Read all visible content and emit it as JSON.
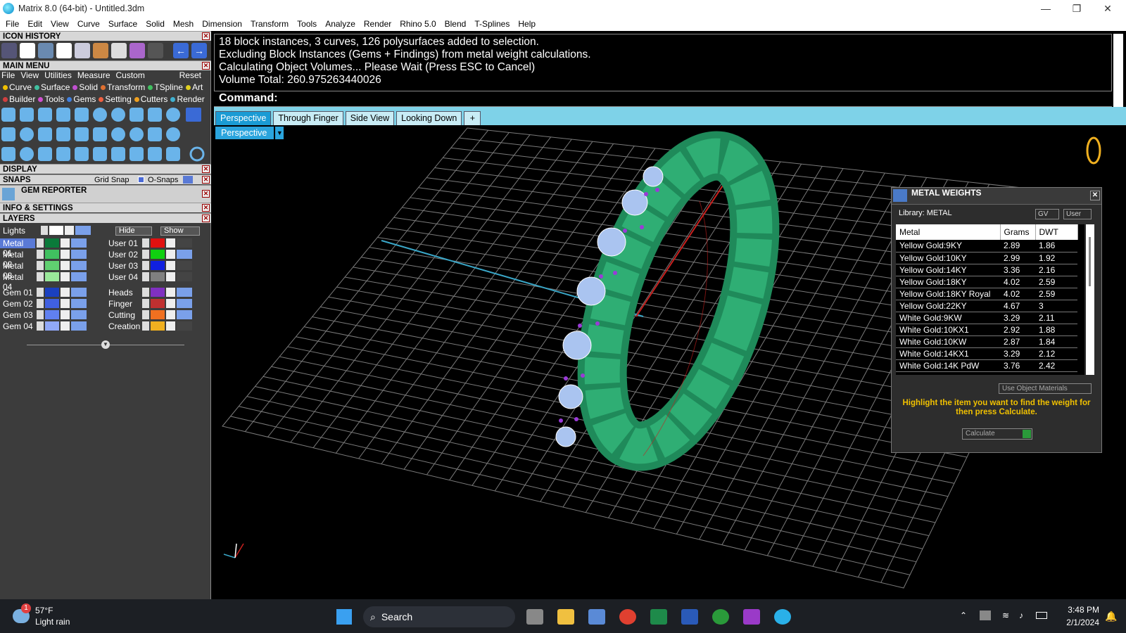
{
  "window": {
    "title": "Matrix 8.0 (64-bit) - Untitled.3dm",
    "minimize": "—",
    "maximize": "❐",
    "close": "✕"
  },
  "menu": [
    "File",
    "Edit",
    "View",
    "Curve",
    "Surface",
    "Solid",
    "Mesh",
    "Dimension",
    "Transform",
    "Tools",
    "Analyze",
    "Render",
    "Rhino 5.0",
    "Blend",
    "T-Splines",
    "Help"
  ],
  "panels": {
    "icon_history": "ICON HISTORY",
    "main_menu": "MAIN MENU",
    "display": "DISPLAY",
    "snaps": "SNAPS",
    "grid_snap": "Grid Snap",
    "osnaps": "O-Snaps",
    "gem_reporter": "GEM REPORTER",
    "info_settings": "INFO & SETTINGS",
    "layers": "LAYERS"
  },
  "main_menu_items": [
    "File",
    "View",
    "Utilities",
    "Measure",
    "Custom"
  ],
  "reset": "Reset",
  "cat_row1": [
    {
      "label": "Curve",
      "color": "#f0c000"
    },
    {
      "label": "Surface",
      "color": "#40c0a0"
    },
    {
      "label": "Solid",
      "color": "#c050d0"
    },
    {
      "label": "Transform",
      "color": "#e07030"
    },
    {
      "label": "TSpline",
      "color": "#40c060"
    },
    {
      "label": "Art",
      "color": "#e0d020"
    }
  ],
  "cat_row2": [
    {
      "label": "Builder",
      "color": "#d04040"
    },
    {
      "label": "Tools",
      "color": "#d050d0"
    },
    {
      "label": "Gems",
      "color": "#4080e0"
    },
    {
      "label": "Setting",
      "color": "#f06040"
    },
    {
      "label": "Cutters",
      "color": "#f0a020"
    },
    {
      "label": "Render",
      "color": "#40b0d0"
    }
  ],
  "layers": {
    "lights": "Lights",
    "hide": "Hide",
    "show": "Show",
    "left": [
      {
        "name": "Metal 01",
        "color": "#0a7a3a",
        "selected": true
      },
      {
        "name": "Metal 02",
        "color": "#40c060"
      },
      {
        "name": "Metal 03",
        "color": "#60d070"
      },
      {
        "name": "Metal 04",
        "color": "#9ae89a"
      },
      {
        "name": "Gem 01",
        "color": "#1a40c0"
      },
      {
        "name": "Gem 02",
        "color": "#4060e0"
      },
      {
        "name": "Gem 03",
        "color": "#6080f0"
      },
      {
        "name": "Gem 04",
        "color": "#90a8f8"
      }
    ],
    "right": [
      {
        "name": "User 01",
        "color": "#e01010"
      },
      {
        "name": "User 02",
        "color": "#10d010"
      },
      {
        "name": "User 03",
        "color": "#1020e0"
      },
      {
        "name": "User 04",
        "color": "#808080"
      },
      {
        "name": "Heads",
        "color": "#8030c0"
      },
      {
        "name": "Finger",
        "color": "#c03030"
      },
      {
        "name": "Cutting",
        "color": "#f07020"
      },
      {
        "name": "Creation",
        "color": "#f0b020"
      }
    ]
  },
  "command": {
    "history": [
      "18 block instances, 3 curves, 126 polysurfaces added to selection.",
      "Excluding Block Instances (Gems + Findings) from metal weight calculations.",
      "Calculating Object Volumes... Please Wait (Press ESC to Cancel)",
      "Volume Total: 260.975263440026"
    ],
    "prompt": "Command:"
  },
  "viewport_tabs": [
    "Perspective",
    "Through Finger",
    "Side View",
    "Looking Down"
  ],
  "viewport_label": "Perspective",
  "metal_weights": {
    "title": "METAL WEIGHTS",
    "library": "Library: METAL",
    "gv": "GV",
    "user": "User",
    "columns": [
      "Metal",
      "Grams",
      "DWT"
    ],
    "rows": [
      [
        "Yellow Gold:9KY",
        "2.89",
        "1.86"
      ],
      [
        "Yellow Gold:10KY",
        "2.99",
        "1.92"
      ],
      [
        "Yellow Gold:14KY",
        "3.36",
        "2.16"
      ],
      [
        "Yellow Gold:18KY",
        "4.02",
        "2.59"
      ],
      [
        "Yellow Gold:18KY Royal",
        "4.02",
        "2.59"
      ],
      [
        "Yellow Gold:22KY",
        "4.67",
        "3"
      ],
      [
        "White Gold:9KW",
        "3.29",
        "2.11"
      ],
      [
        "White Gold:10KX1",
        "2.92",
        "1.88"
      ],
      [
        "White Gold:10KW",
        "2.87",
        "1.84"
      ],
      [
        "White Gold:14KX1",
        "3.29",
        "2.12"
      ],
      [
        "White Gold:14K PdW",
        "3.76",
        "2.42"
      ]
    ],
    "use_object_materials": "Use Object Materials",
    "hint": "Highlight the item you want to find the weight for then press Calculate.",
    "calculate": "Calculate"
  },
  "taskbar": {
    "weather_temp": "57°F",
    "weather_desc": "Light rain",
    "weather_badge": "1",
    "search": "Search",
    "time": "3:48 PM",
    "date": "2/1/2024"
  }
}
